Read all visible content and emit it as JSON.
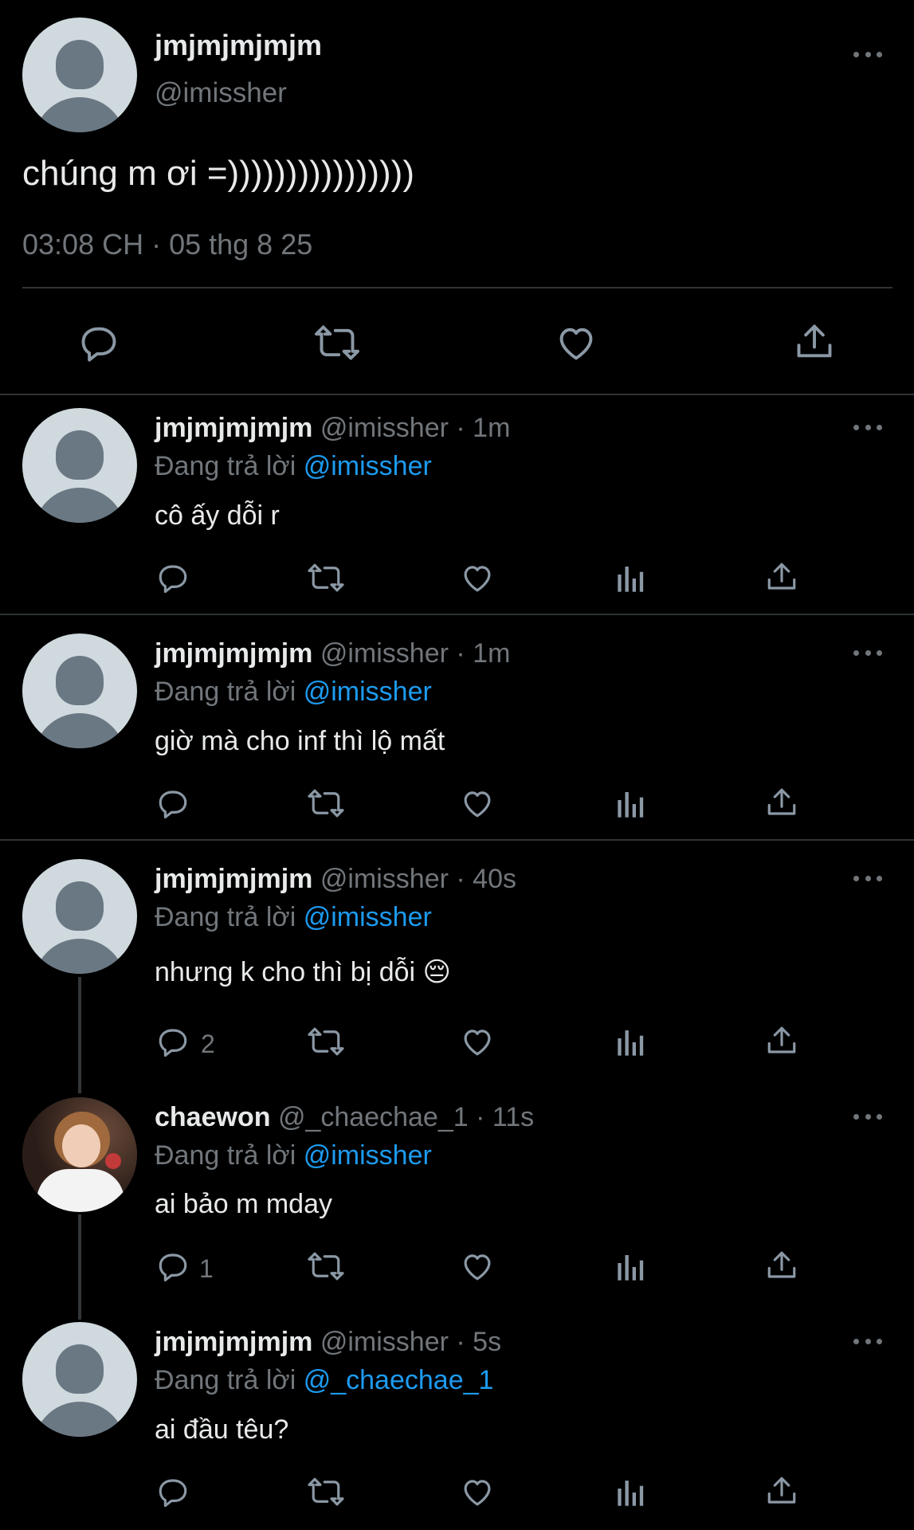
{
  "main_tweet": {
    "display_name": "jmjmjmjmjm",
    "handle": "@imissher",
    "text": "chúng m ơi =))))))))))))))))",
    "timestamp": "03:08 CH · 05 thg 8 25"
  },
  "replying_to_label": "Đang trả lời",
  "replies": [
    {
      "display_name": "jmjmjmjmjm",
      "handle": "@imissher",
      "time": "· 1m",
      "reply_to": "@imissher",
      "text": "cô ấy dỗi r",
      "reply_count": ""
    },
    {
      "display_name": "jmjmjmjmjm",
      "handle": "@imissher",
      "time": "· 1m",
      "reply_to": "@imissher",
      "text": "giờ mà cho inf thì lộ mất",
      "reply_count": ""
    },
    {
      "display_name": "jmjmjmjmjm",
      "handle": "@imissher",
      "time": "· 40s",
      "reply_to": "@imissher",
      "text": "nhưng k cho thì bị dỗi 😔",
      "reply_count": "2"
    },
    {
      "display_name": "chaewon",
      "handle": "@_chaechae_1",
      "time": "· 11s",
      "reply_to": "@imissher",
      "text": "ai bảo m mday",
      "reply_count": "1"
    },
    {
      "display_name": "jmjmjmjmjm",
      "handle": "@imissher",
      "time": "· 5s",
      "reply_to": "@_chaechae_1",
      "text": "ai đầu têu?",
      "reply_count": ""
    }
  ],
  "colors": {
    "background": "#000000",
    "text": "#e7e9ea",
    "muted": "#71767b",
    "link": "#1d9bf0",
    "divider": "#2f3336"
  },
  "icons": [
    "reply-icon",
    "retweet-icon",
    "like-icon",
    "views-icon",
    "share-icon",
    "more-icon"
  ]
}
